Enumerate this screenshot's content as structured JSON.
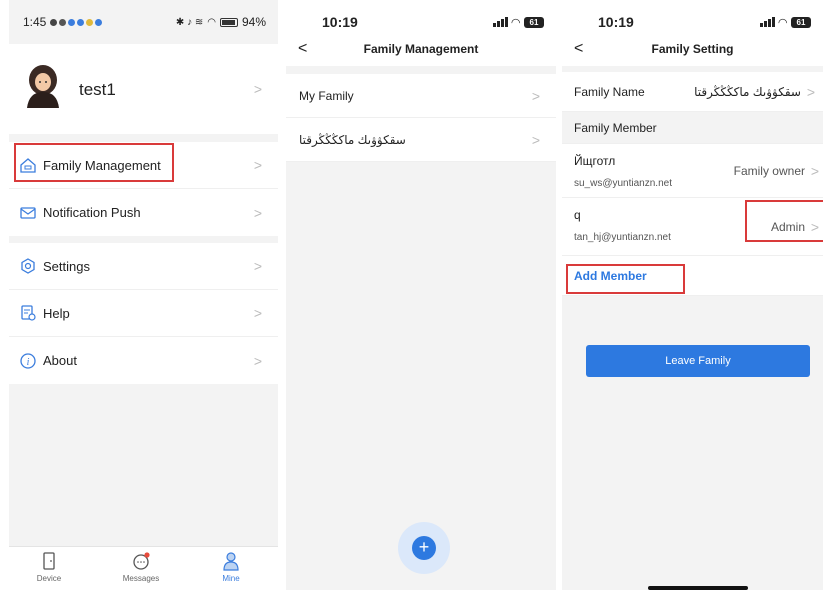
{
  "panel1": {
    "status": {
      "time": "1:45",
      "battery": "94%"
    },
    "profile": {
      "name": "test1"
    },
    "menu": [
      {
        "label": "Family Management",
        "icon": "family-icon"
      },
      {
        "label": "Notification Push",
        "icon": "mail-icon"
      },
      {
        "label": "Settings",
        "icon": "settings-icon"
      },
      {
        "label": "Help",
        "icon": "help-icon"
      },
      {
        "label": "About",
        "icon": "info-icon"
      }
    ],
    "tabs": [
      {
        "label": "Device",
        "icon": "device-icon"
      },
      {
        "label": "Messages",
        "icon": "messages-icon"
      },
      {
        "label": "Mine",
        "icon": "user-icon"
      }
    ]
  },
  "panel2": {
    "status": {
      "time": "10:19",
      "battery": "61"
    },
    "title": "Family Management",
    "families": [
      "My Family",
      "سقكۋۋىك ماكڭڭڭرقتا"
    ]
  },
  "panel3": {
    "status": {
      "time": "10:19",
      "battery": "61"
    },
    "title": "Family Setting",
    "family_name_label": "Family Name",
    "family_name_value": "سقكۋۋىك ماكڭڭڭرقتا",
    "family_member_label": "Family Member",
    "members": [
      {
        "name": "Йщготл",
        "email": "su_ws@yuntianzn.net",
        "role": "Family owner"
      },
      {
        "name": "q",
        "email": "tan_hj@yuntianzn.net",
        "role": "Admin"
      }
    ],
    "add_member": "Add Member",
    "leave_family": "Leave Family"
  },
  "colors": {
    "accent": "#2d79e0",
    "highlight": "#d93a3a",
    "badge": "#e74c3c"
  }
}
